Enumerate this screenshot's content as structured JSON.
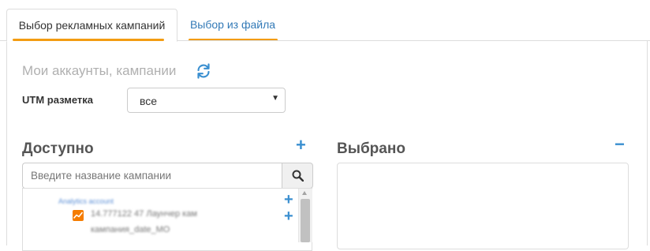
{
  "tabs": [
    {
      "label": "Выбор рекламных кампаний",
      "active": true
    },
    {
      "label": "Выбор из файла",
      "active": false
    }
  ],
  "section_title": "Мои аккаунты, кампании",
  "utm": {
    "label": "UTM разметка",
    "selected": "все"
  },
  "available": {
    "title": "Доступно",
    "search_placeholder": "Введите название кампании",
    "account_name": "Analytics account",
    "campaign_line1": "14.777122 47 Лаунчер кам",
    "campaign_line2": "кампания_date_MO"
  },
  "selected": {
    "title": "Выбрано"
  },
  "colors": {
    "accent": "#f39c12",
    "link": "#337ab7",
    "action": "#3a8fd0",
    "analytics_icon": "#f57c00"
  }
}
